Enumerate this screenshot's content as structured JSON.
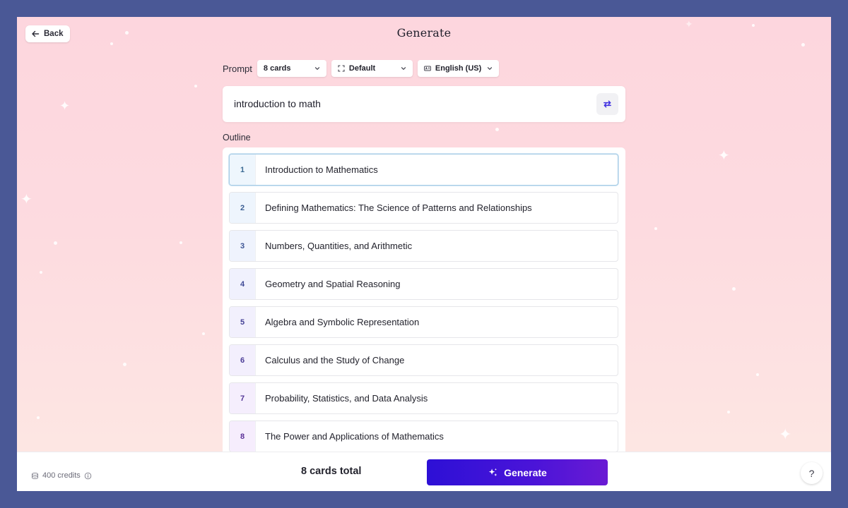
{
  "header": {
    "back_label": "Back",
    "title": "Generate"
  },
  "controls": {
    "prompt_label": "Prompt",
    "card_count": "8 cards",
    "theme": "Default",
    "language": "English (US)"
  },
  "prompt": {
    "text": "introduction to math"
  },
  "outline": {
    "label": "Outline",
    "items": [
      {
        "num": "1",
        "title": "Introduction to Mathematics"
      },
      {
        "num": "2",
        "title": "Defining Mathematics: The Science of Patterns and Relationships"
      },
      {
        "num": "3",
        "title": "Numbers, Quantities, and Arithmetic"
      },
      {
        "num": "4",
        "title": "Geometry and Spatial Reasoning"
      },
      {
        "num": "5",
        "title": "Algebra and Symbolic Representation"
      },
      {
        "num": "6",
        "title": "Calculus and the Study of Change"
      },
      {
        "num": "7",
        "title": "Probability, Statistics, and Data Analysis"
      },
      {
        "num": "8",
        "title": "The Power and Applications of Mathematics"
      }
    ]
  },
  "footer": {
    "credits": "400 credits",
    "total": "8 cards total",
    "generate_label": "Generate",
    "help_label": "?"
  },
  "colors": {
    "outer_background": "#4a5896",
    "accent": "#3b12d8",
    "active_border": "#a8cde6"
  },
  "icons": [
    "arrow-left-icon",
    "chevron-down-icon",
    "frame-icon",
    "language-icon",
    "shuffle-icon",
    "coins-icon",
    "info-icon",
    "sparkles-icon"
  ]
}
